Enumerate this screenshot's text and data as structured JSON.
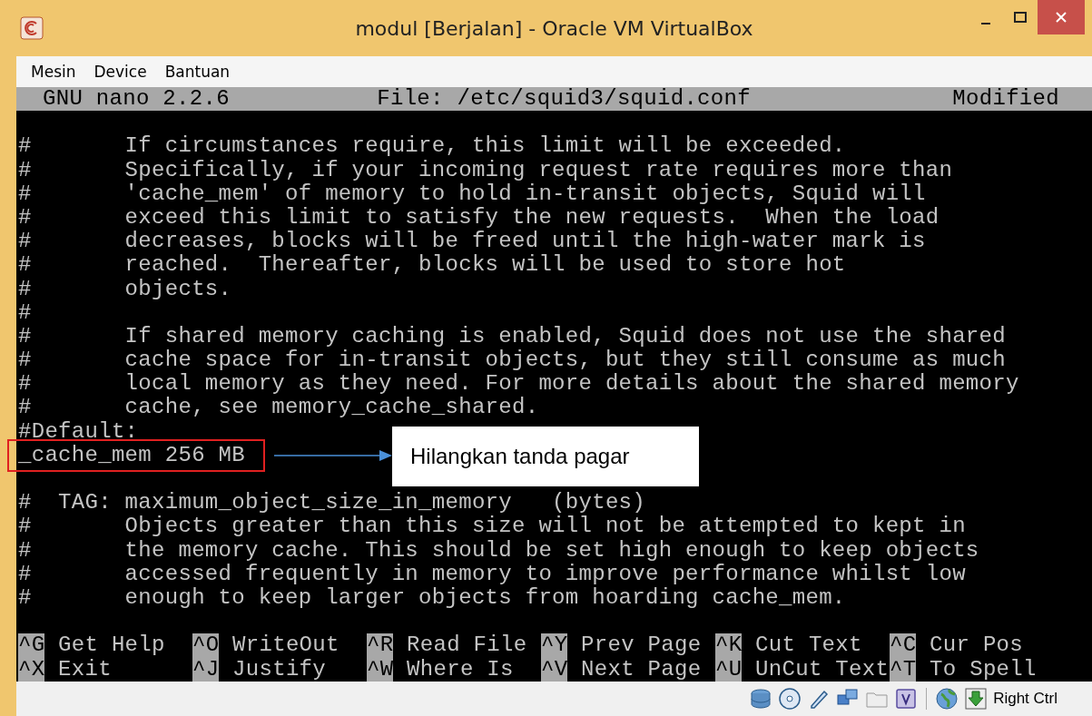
{
  "window": {
    "title": "modul [Berjalan] - Oracle VM VirtualBox"
  },
  "menu": [
    "Mesin",
    "Device",
    "Bantuan"
  ],
  "nano": {
    "version": "GNU nano 2.2.6",
    "file": "File: /etc/squid3/squid.conf",
    "status": "Modified"
  },
  "lines": [
    {
      "kind": "blank"
    },
    {
      "kind": "text",
      "text": "#       If circumstances require, this limit will be exceeded."
    },
    {
      "kind": "text",
      "text": "#       Specifically, if your incoming request rate requires more than"
    },
    {
      "kind": "text",
      "text": "#       'cache_mem' of memory to hold in-transit objects, Squid will"
    },
    {
      "kind": "text",
      "text": "#       exceed this limit to satisfy the new requests.  When the load"
    },
    {
      "kind": "text",
      "text": "#       decreases, blocks will be freed until the high-water mark is"
    },
    {
      "kind": "text",
      "text": "#       reached.  Thereafter, blocks will be used to store hot"
    },
    {
      "kind": "text",
      "text": "#       objects."
    },
    {
      "kind": "text",
      "text": "#"
    },
    {
      "kind": "text",
      "text": "#       If shared memory caching is enabled, Squid does not use the shared"
    },
    {
      "kind": "text",
      "text": "#       cache space for in-transit objects, but they still consume as much"
    },
    {
      "kind": "text",
      "text": "#       local memory as they need. For more details about the shared memory"
    },
    {
      "kind": "text",
      "text": "#       cache, see memory_cache_shared."
    },
    {
      "kind": "text",
      "text": "#Default:"
    },
    {
      "kind": "text",
      "text": "_cache_mem 256 MB",
      "annotation": "Hilangkan tanda pagar"
    },
    {
      "kind": "blank"
    },
    {
      "kind": "text",
      "text": "#  TAG: maximum_object_size_in_memory   (bytes)"
    },
    {
      "kind": "text",
      "text": "#       Objects greater than this size will not be attempted to kept in"
    },
    {
      "kind": "text",
      "text": "#       the memory cache. This should be set high enough to keep objects"
    },
    {
      "kind": "text",
      "text": "#       accessed frequently in memory to improve performance whilst low"
    },
    {
      "kind": "text",
      "text": "#       enough to keep larger objects from hoarding cache_mem."
    },
    {
      "kind": "blank"
    }
  ],
  "shortcuts": [
    [
      {
        "key": "^G",
        "label": "Get Help"
      },
      {
        "key": "^O",
        "label": "WriteOut"
      },
      {
        "key": "^R",
        "label": "Read File"
      },
      {
        "key": "^Y",
        "label": "Prev Page"
      },
      {
        "key": "^K",
        "label": "Cut Text"
      },
      {
        "key": "^C",
        "label": "Cur Pos"
      }
    ],
    [
      {
        "key": "^X",
        "label": "Exit"
      },
      {
        "key": "^J",
        "label": "Justify"
      },
      {
        "key": "^W",
        "label": "Where Is"
      },
      {
        "key": "^V",
        "label": "Next Page"
      },
      {
        "key": "^U",
        "label": "UnCut Text"
      },
      {
        "key": "^T",
        "label": "To Spell"
      }
    ]
  ],
  "status_bar": {
    "host_key": "Right Ctrl"
  }
}
